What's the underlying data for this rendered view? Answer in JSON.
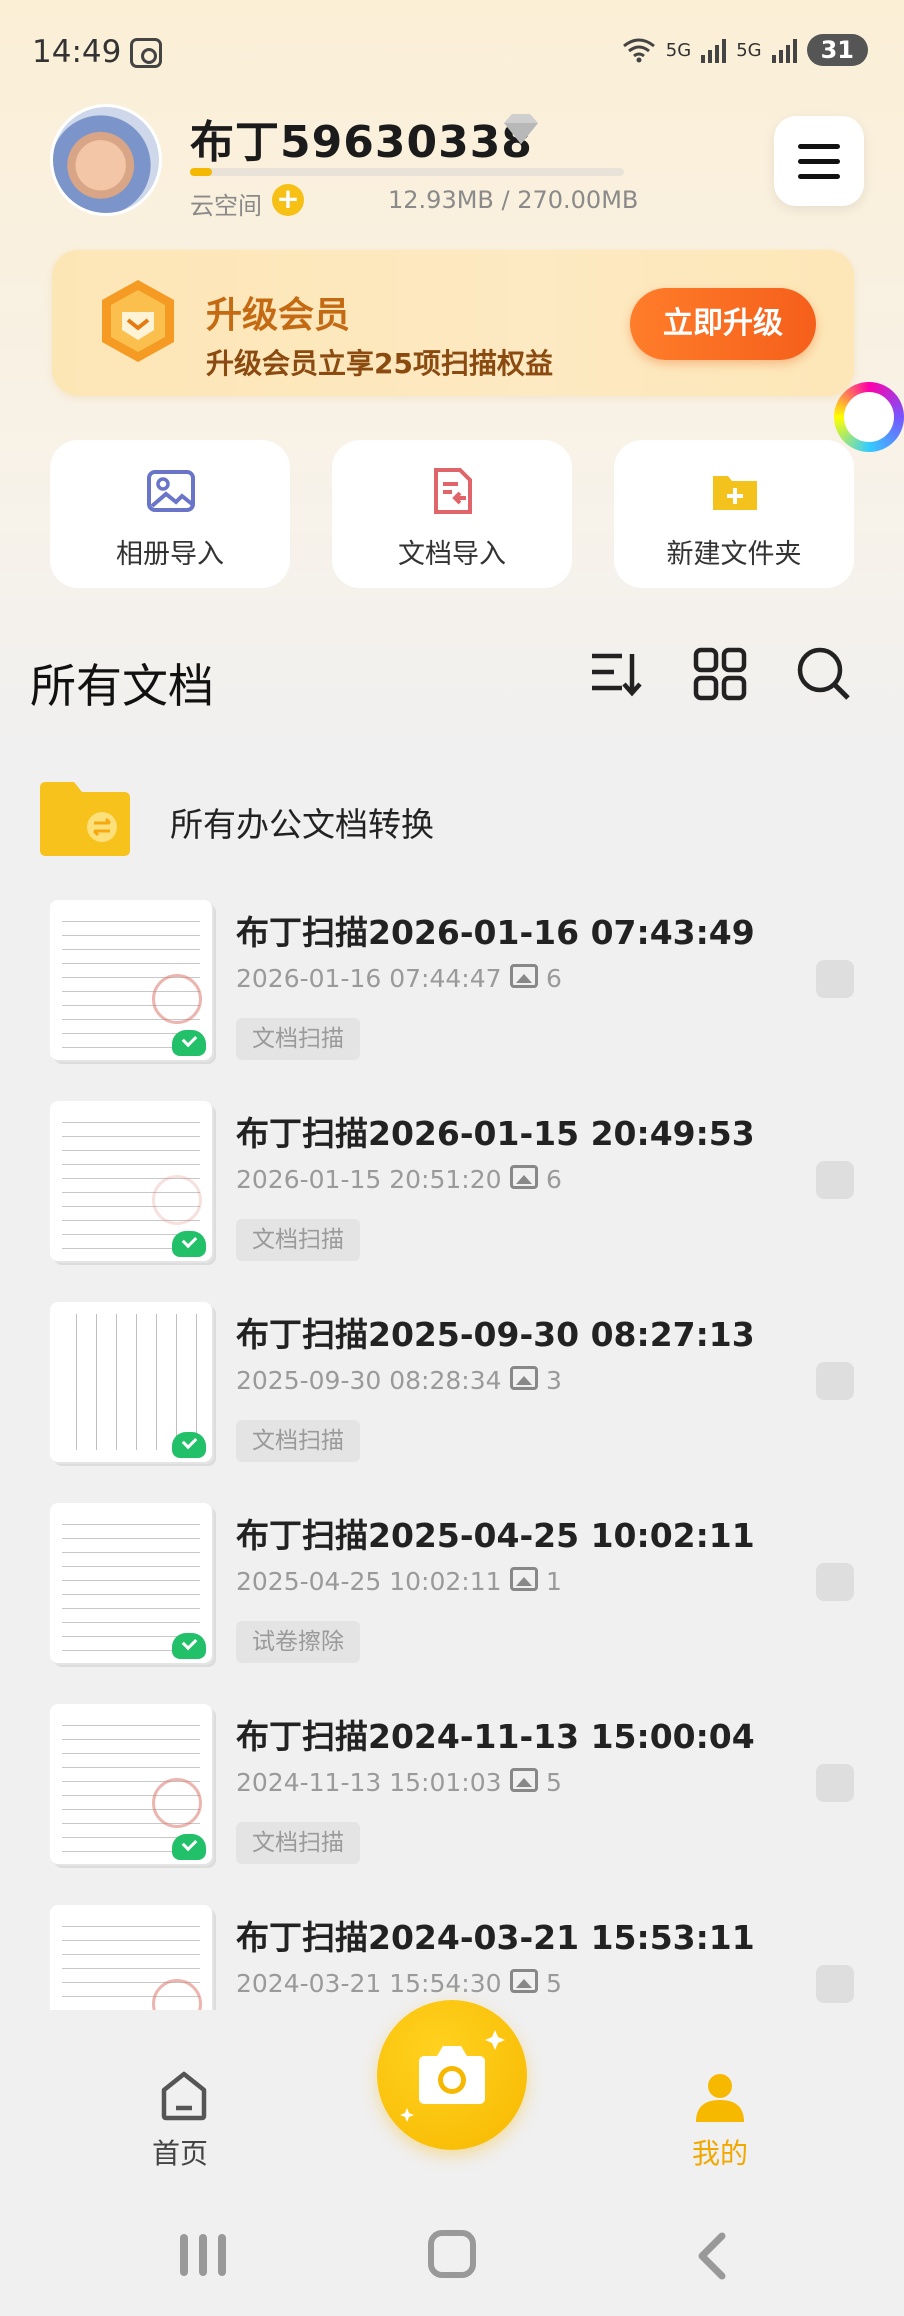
{
  "status_bar": {
    "time": "14:49",
    "network_1": "5G",
    "network_2": "5G",
    "battery": "31"
  },
  "profile": {
    "username": "布丁59630338",
    "cloud_label": "云空间",
    "storage_used_fraction": 0.05,
    "storage_text": "12.93MB / 270.00MB"
  },
  "banner": {
    "title": "升级会员",
    "subtitle": "升级会员立享25项扫描权益",
    "button": "立即升级"
  },
  "quick_actions": [
    {
      "label": "相册导入",
      "icon": "image-import-icon"
    },
    {
      "label": "文档导入",
      "icon": "document-import-icon"
    },
    {
      "label": "新建文件夹",
      "icon": "new-folder-icon"
    }
  ],
  "section": {
    "title": "所有文档"
  },
  "office_folder": {
    "label": "所有办公文档转换"
  },
  "documents": [
    {
      "title": "布丁扫描2026-01-16 07:43:49",
      "date": "2026-01-16 07:44:47",
      "images": "6",
      "tag": "文档扫描",
      "synced": true
    },
    {
      "title": "布丁扫描2026-01-15 20:49:53",
      "date": "2026-01-15 20:51:20",
      "images": "6",
      "tag": "文档扫描",
      "synced": true
    },
    {
      "title": "布丁扫描2025-09-30 08:27:13",
      "date": "2025-09-30 08:28:34",
      "images": "3",
      "tag": "文档扫描",
      "synced": true
    },
    {
      "title": "布丁扫描2025-04-25 10:02:11",
      "date": "2025-04-25 10:02:11",
      "images": "1",
      "tag": "试卷擦除",
      "synced": true
    },
    {
      "title": "布丁扫描2024-11-13 15:00:04",
      "date": "2024-11-13 15:01:03",
      "images": "5",
      "tag": "文档扫描",
      "synced": true
    },
    {
      "title": "布丁扫描2024-03-21 15:53:11",
      "date": "2024-03-21 15:54:30",
      "images": "5",
      "tag": "",
      "synced": false
    }
  ],
  "bottom_nav": {
    "home": "首页",
    "mine": "我的"
  },
  "colors": {
    "accent": "#F7B800",
    "upgrade": "#F55F1B",
    "sync": "#23C06A"
  }
}
